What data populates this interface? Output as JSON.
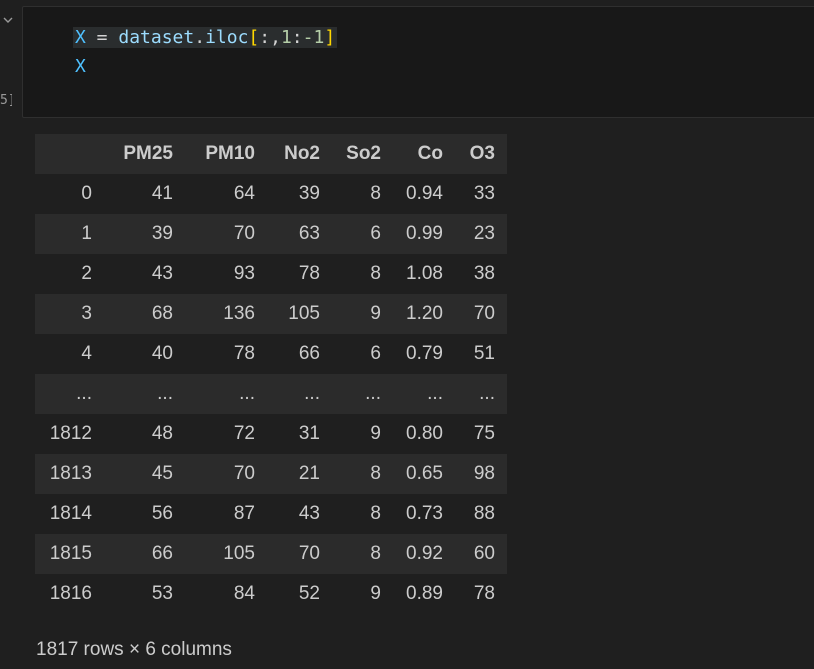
{
  "cell": {
    "execution_count": "5]",
    "code": {
      "line1": {
        "var": "X",
        "op": " = ",
        "obj": "dataset",
        "dot": ".",
        "attr": "iloc",
        "open": "[",
        "slice_a": ":,",
        "num1": "1",
        "colon": ":",
        "num2": "-1",
        "close": "]"
      },
      "line2": {
        "var": "X"
      }
    }
  },
  "dataframe": {
    "index_header": "",
    "columns": [
      "PM25",
      "PM10",
      "No2",
      "So2",
      "Co",
      "O3"
    ],
    "rows": [
      {
        "index": "0",
        "values": [
          "41",
          "64",
          "39",
          "8",
          "0.94",
          "33"
        ]
      },
      {
        "index": "1",
        "values": [
          "39",
          "70",
          "63",
          "6",
          "0.99",
          "23"
        ]
      },
      {
        "index": "2",
        "values": [
          "43",
          "93",
          "78",
          "8",
          "1.08",
          "38"
        ]
      },
      {
        "index": "3",
        "values": [
          "68",
          "136",
          "105",
          "9",
          "1.20",
          "70"
        ]
      },
      {
        "index": "4",
        "values": [
          "40",
          "78",
          "66",
          "6",
          "0.79",
          "51"
        ]
      },
      {
        "index": "...",
        "values": [
          "...",
          "...",
          "...",
          "...",
          "...",
          "..."
        ]
      },
      {
        "index": "1812",
        "values": [
          "48",
          "72",
          "31",
          "9",
          "0.80",
          "75"
        ]
      },
      {
        "index": "1813",
        "values": [
          "45",
          "70",
          "21",
          "8",
          "0.65",
          "98"
        ]
      },
      {
        "index": "1814",
        "values": [
          "56",
          "87",
          "43",
          "8",
          "0.73",
          "88"
        ]
      },
      {
        "index": "1815",
        "values": [
          "66",
          "105",
          "70",
          "8",
          "0.92",
          "60"
        ]
      },
      {
        "index": "1816",
        "values": [
          "53",
          "84",
          "52",
          "9",
          "0.89",
          "78"
        ]
      }
    ],
    "shape_text": "1817 rows × 6 columns"
  },
  "colors": {
    "background": "#1f1f1f",
    "cell_background": "#181818",
    "row_stripe": "#2b2b2b",
    "text": "#cccccc"
  },
  "icons": {
    "collapse": "chevron-down-icon"
  }
}
